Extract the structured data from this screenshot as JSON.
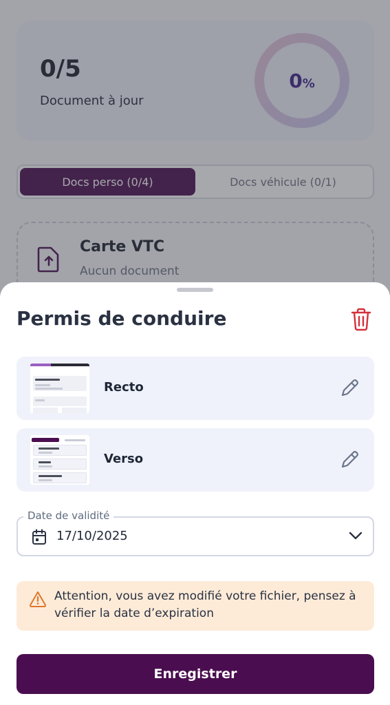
{
  "background": {
    "stats": {
      "count": "0/5",
      "label": "Document à jour",
      "percent_value": "0",
      "percent_sign": "%",
      "progress": 0
    },
    "tabs": [
      {
        "label": "Docs perso (0/4)",
        "active": true
      },
      {
        "label": "Docs véhicule (0/1)",
        "active": false
      }
    ],
    "doc_card": {
      "title": "Carte VTC",
      "subtitle": "Aucun document"
    }
  },
  "sheet": {
    "title": "Permis de conduire",
    "files": [
      {
        "label": "Recto"
      },
      {
        "label": "Verso"
      }
    ],
    "date_field": {
      "legend": "Date de validité",
      "value": "17/10/2025"
    },
    "alert": {
      "message": "Attention, vous avez modifié votre fichier, pensez à vérifier la date d’expiration"
    },
    "save_label": "Enregistrer"
  },
  "colors": {
    "primary": "#4a0e50",
    "alert_bg": "#fdebd8",
    "alert_icon": "#e0762a",
    "danger": "#d3303a"
  },
  "icons": {
    "trash": "trash-icon",
    "edit": "pencil-icon",
    "calendar": "calendar-icon",
    "chevron": "chevron-down-icon",
    "warning": "warning-icon",
    "upload": "file-upload-icon"
  }
}
